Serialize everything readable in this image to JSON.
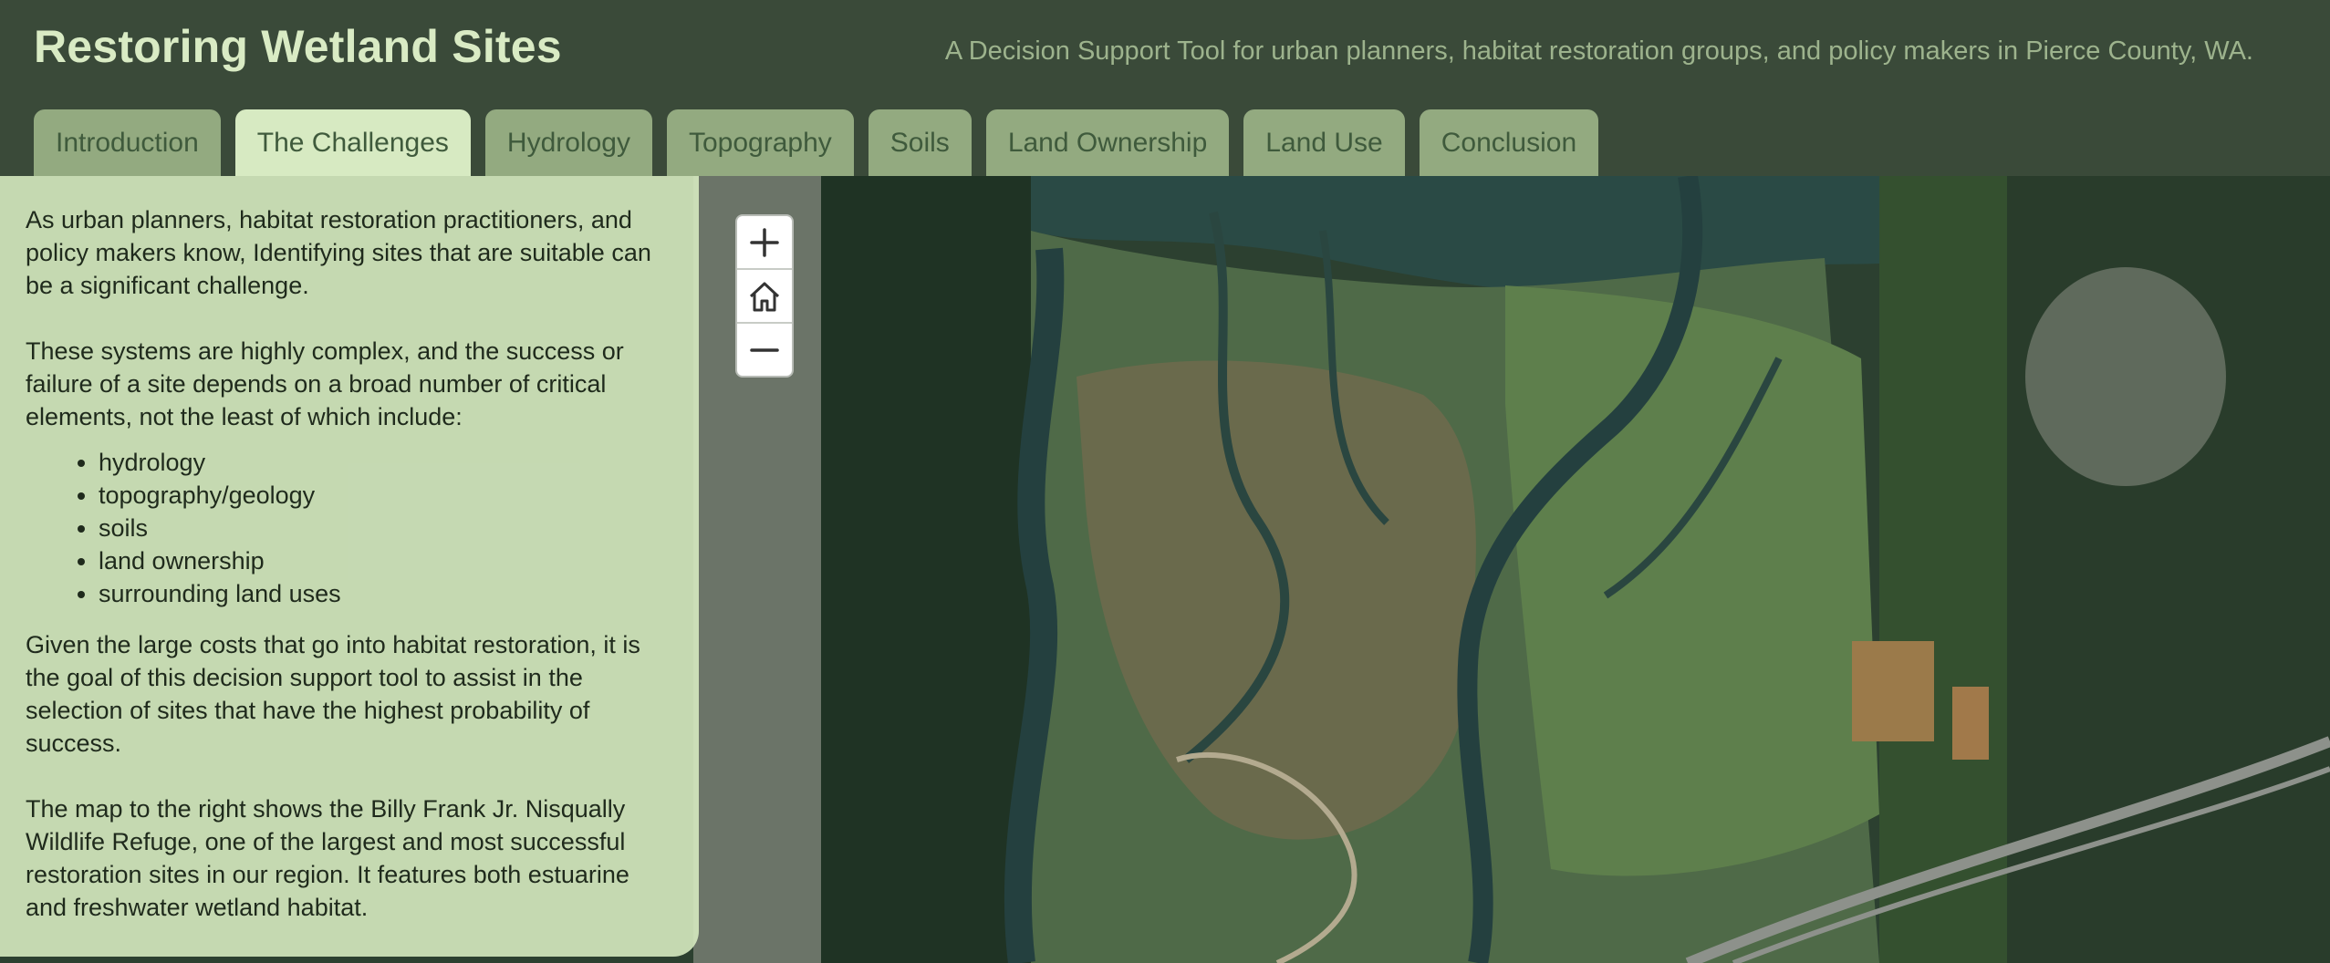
{
  "header": {
    "title": "Restoring Wetland Sites",
    "subtitle": "A Decision Support Tool for urban planners, habitat restoration groups, and policy makers in Pierce County, WA."
  },
  "tabs": [
    {
      "label": "Introduction",
      "active": false
    },
    {
      "label": "The Challenges",
      "active": true
    },
    {
      "label": "Hydrology",
      "active": false
    },
    {
      "label": "Topography",
      "active": false
    },
    {
      "label": "Soils",
      "active": false
    },
    {
      "label": "Land Ownership",
      "active": false
    },
    {
      "label": "Land Use",
      "active": false
    },
    {
      "label": "Conclusion",
      "active": false
    }
  ],
  "panel": {
    "para1": "As urban planners, habitat restoration practitioners, and policy makers know, Identifying sites that are suitable can be a significant challenge.",
    "para2": "These systems are highly complex, and the success or failure of a site depends on a broad number of critical elements, not the least of which include:",
    "list": [
      "hydrology",
      "topography/geology",
      "soils",
      "land ownership",
      "surrounding land uses"
    ],
    "para3": "Given the large costs that go into habitat restoration, it is the goal of this decision support tool to assist in the selection of sites that have the highest probability of success.",
    "para4": "The map to the right shows the Billy Frank Jr. Nisqually Wildlife Refuge, one of the largest and most successful restoration sites in our region. It features both estuarine and freshwater wetland habitat."
  },
  "map_controls": {
    "zoom_in_icon": "plus-icon",
    "home_icon": "home-icon",
    "zoom_out_icon": "minus-icon"
  },
  "colors": {
    "header_bg": "#3a4a39",
    "title": "#d9ebc4",
    "tab_inactive": "#93aa80",
    "tab_active": "#d7eac2",
    "panel_bg": "#d6eac0"
  }
}
